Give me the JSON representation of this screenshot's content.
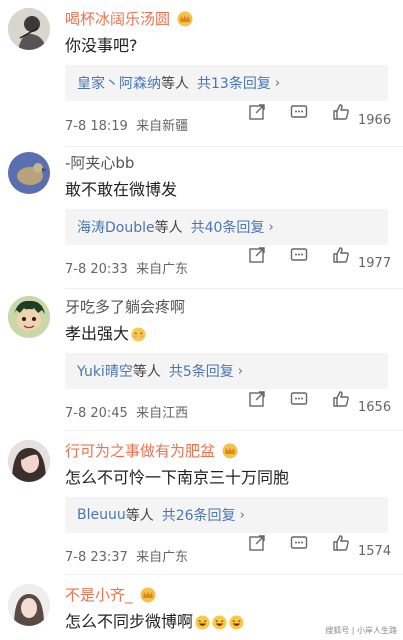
{
  "comments": [
    {
      "user": "喝杯冰阔乐汤圆",
      "name_color": "orange",
      "crown": true,
      "text": "你没事吧?",
      "emojis": 0,
      "reply_names": "皇家丶阿森纳",
      "reply_suffix": "等人",
      "reply_count": "共13条回复",
      "time": "7-8 18:19",
      "location": "来自新疆",
      "likes": "1966",
      "avatar": "sketch-person"
    },
    {
      "user": "-阿夹心bb",
      "name_color": "gray",
      "crown": false,
      "text": "敢不敢在微博发",
      "emojis": 0,
      "reply_names": "海涛Double",
      "reply_suffix": "等人",
      "reply_count": "共40条回复",
      "time": "7-8 20:33",
      "location": "来自广东",
      "likes": "1977",
      "avatar": "bird"
    },
    {
      "user": "牙吃多了躺会疼啊",
      "name_color": "gray",
      "crown": false,
      "text": "孝出强大",
      "emojis": 1,
      "reply_names": "Yuki晴空",
      "reply_suffix": "等人",
      "reply_count": "共5条回复",
      "time": "7-8 20:45",
      "location": "来自江西",
      "likes": "1656",
      "avatar": "anime-boy"
    },
    {
      "user": "行可为之事做有为肥盆",
      "name_color": "orange",
      "crown": true,
      "text": "怎么不可怜一下南京三十万同胞",
      "emojis": 0,
      "reply_names": "Bleuuu",
      "reply_suffix": "等人",
      "reply_count": "共26条回复",
      "time": "7-8 23:37",
      "location": "来自广东",
      "likes": "1574",
      "avatar": "girl-hair"
    },
    {
      "user": "不是小齐_",
      "name_color": "orange",
      "crown": true,
      "text": "怎么不同步微博啊",
      "emojis": 3,
      "avatar": "girl-portrait"
    }
  ],
  "watermark": "搜狐号 | 小岸人生路"
}
